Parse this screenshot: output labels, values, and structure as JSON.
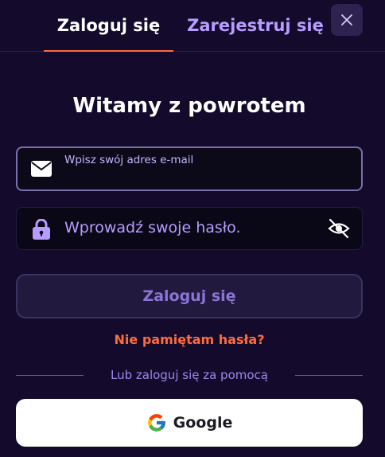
{
  "tabs": {
    "login": "Zaloguj się",
    "register": "Zarejestruj się"
  },
  "title": "Witamy z powrotem",
  "email": {
    "label": "Wpisz swój adres e-mail"
  },
  "password": {
    "placeholder": "Wprowadź swoje hasło."
  },
  "login_button": "Zaloguj się",
  "forgot_password": "Nie pamiętam hasła?",
  "divider_text": "Lub zaloguj się za pomocą",
  "google_button": "Google",
  "colors": {
    "background": "#140b2c",
    "accent": "#ff6b3d",
    "purple": "#b79dff"
  },
  "icons": {
    "close": "close-icon",
    "email": "envelope-icon",
    "password": "lock-icon",
    "visibility": "eye-off-icon",
    "google": "google-logo-icon"
  }
}
